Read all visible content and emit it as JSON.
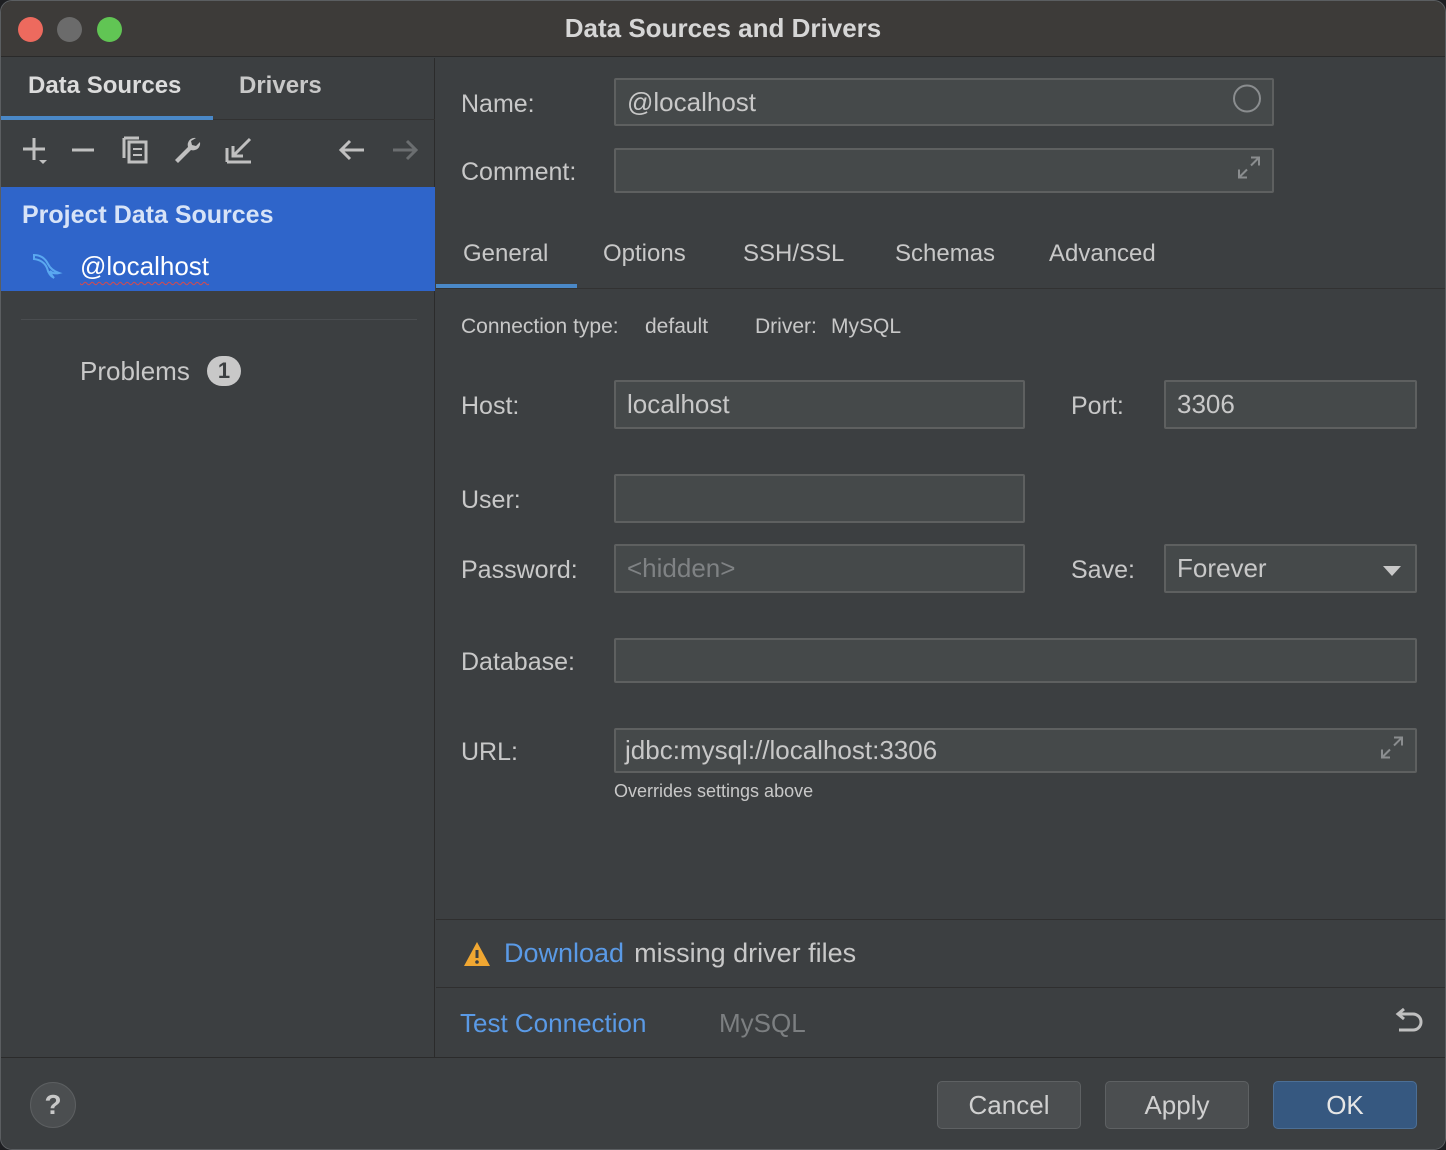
{
  "window": {
    "title": "Data Sources and Drivers"
  },
  "sidebar": {
    "tabs": [
      {
        "label": "Data Sources"
      },
      {
        "label": "Drivers"
      }
    ],
    "toolbar": [
      "add-icon",
      "remove-icon",
      "duplicate-icon",
      "wrench-icon",
      "import-icon",
      "back-arrow-icon",
      "forward-arrow-icon"
    ],
    "tree": {
      "header": "Project Data Sources",
      "items": [
        {
          "label": "@localhost",
          "icon": "mysql-dolphin-icon"
        }
      ]
    },
    "problems": {
      "label": "Problems",
      "count": "1"
    }
  },
  "form": {
    "name": {
      "label": "Name:",
      "value": "@localhost"
    },
    "comment": {
      "label": "Comment:",
      "value": ""
    },
    "tabs": [
      {
        "label": "General"
      },
      {
        "label": "Options"
      },
      {
        "label": "SSH/SSL"
      },
      {
        "label": "Schemas"
      },
      {
        "label": "Advanced"
      }
    ],
    "connection_type": {
      "label": "Connection type:",
      "value": "default"
    },
    "driver": {
      "label": "Driver:",
      "value": "MySQL"
    },
    "host": {
      "label": "Host:",
      "value": "localhost"
    },
    "port": {
      "label": "Port:",
      "value": "3306"
    },
    "user": {
      "label": "User:",
      "value": ""
    },
    "password": {
      "label": "Password:",
      "placeholder": "<hidden>"
    },
    "save": {
      "label": "Save:",
      "value": "Forever"
    },
    "database": {
      "label": "Database:",
      "value": ""
    },
    "url": {
      "label": "URL:",
      "value": "jdbc:mysql://localhost:3306",
      "hint": "Overrides settings above"
    },
    "warning": {
      "link": "Download",
      "text": "missing driver files"
    },
    "test_connection": "Test Connection",
    "driver_name": "MySQL"
  },
  "buttons": {
    "help": "?",
    "cancel": "Cancel",
    "apply": "Apply",
    "ok": "OK"
  },
  "colors": {
    "accent": "#2f65ca",
    "link": "#5a9ae6",
    "warning": "#f0a732",
    "primary_button": "#365880"
  }
}
